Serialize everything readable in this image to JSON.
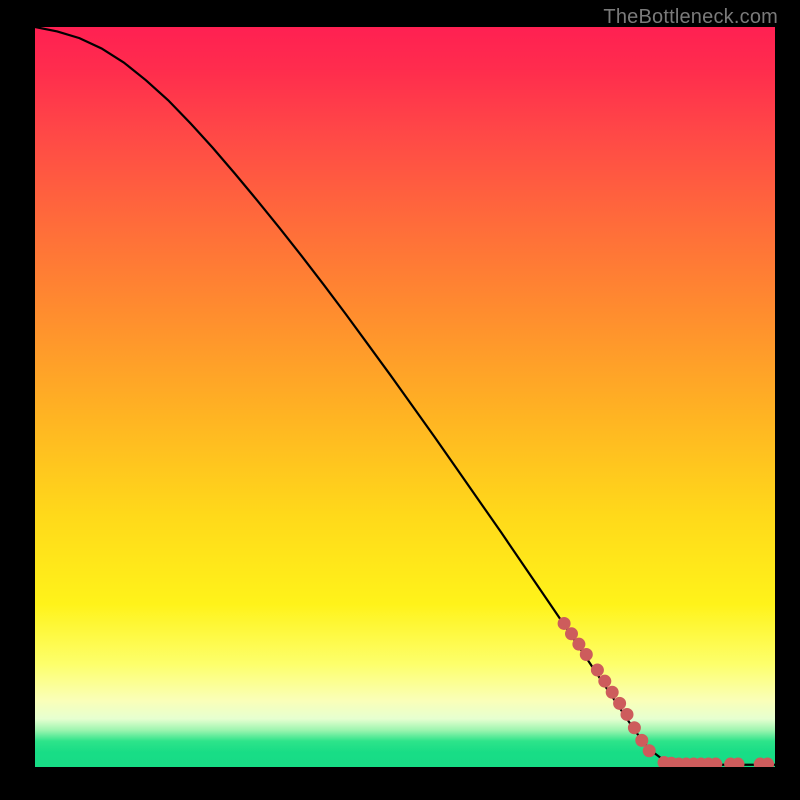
{
  "attribution": "TheBottleneck.com",
  "palette": {
    "curve": "#000000",
    "marker_fill": "#cd5c5c",
    "marker_stroke": "#cd5c5c",
    "gradient_top": "#ff2052",
    "gradient_bottom": "#17dc85",
    "frame": "#000000"
  },
  "chart_data": {
    "type": "line",
    "title": "",
    "xlabel": "",
    "ylabel": "",
    "xlim": [
      0,
      100
    ],
    "ylim": [
      0,
      100
    ],
    "grid": false,
    "legend": false,
    "series": [
      {
        "name": "curve",
        "style": "line",
        "x": [
          0,
          3,
          6,
          9,
          12,
          15,
          18,
          21,
          24,
          27,
          30,
          33,
          36,
          39,
          42,
          45,
          48,
          51,
          54,
          57,
          60,
          63,
          66,
          69,
          72,
          75,
          78,
          81,
          83,
          85,
          88,
          90,
          92,
          94,
          96,
          98,
          100
        ],
        "y": [
          100,
          99.4,
          98.5,
          97.1,
          95.2,
          92.8,
          90.1,
          87.0,
          83.7,
          80.2,
          76.6,
          72.9,
          69.1,
          65.2,
          61.2,
          57.1,
          53.0,
          48.8,
          44.6,
          40.3,
          36.0,
          31.7,
          27.3,
          22.9,
          18.5,
          14.0,
          9.5,
          5.0,
          2.4,
          0.9,
          0.4,
          0.3,
          0.3,
          0.3,
          0.3,
          0.3,
          0.3
        ]
      },
      {
        "name": "markers-descent",
        "style": "scatter",
        "marker_radius": 6,
        "x": [
          71.5,
          72.5,
          73.5,
          74.5,
          76.0,
          77.0,
          78.0,
          79.0,
          80.0,
          81.0,
          82.0,
          83.0
        ],
        "y": [
          19.4,
          18.0,
          16.6,
          15.2,
          13.1,
          11.6,
          10.1,
          8.6,
          7.1,
          5.3,
          3.6,
          2.2
        ]
      },
      {
        "name": "markers-flat",
        "style": "scatter",
        "marker_radius": 6,
        "x": [
          85.0,
          86.0,
          87.0,
          88.0,
          89.0,
          90.0,
          91.0,
          92.0,
          94.0,
          95.0,
          98.0,
          99.0
        ],
        "y": [
          0.6,
          0.5,
          0.4,
          0.4,
          0.4,
          0.4,
          0.4,
          0.4,
          0.4,
          0.4,
          0.4,
          0.4
        ]
      }
    ]
  }
}
